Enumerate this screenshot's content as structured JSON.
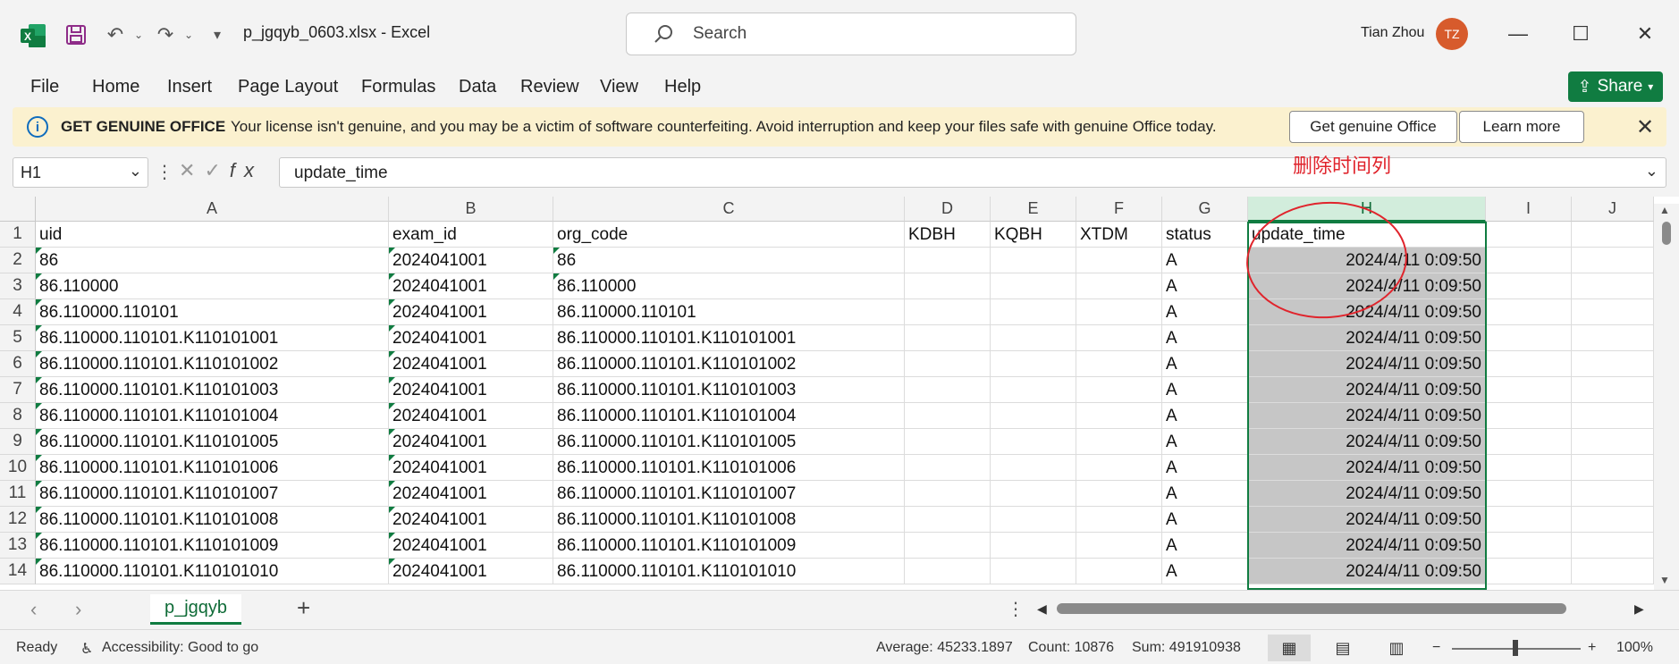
{
  "app": {
    "title": "p_jgqyb_0603.xlsx  -  Excel",
    "search_placeholder": "Search",
    "user_name": "Tian Zhou",
    "user_initials": "TZ"
  },
  "menu": [
    "File",
    "Home",
    "Insert",
    "Page Layout",
    "Formulas",
    "Data",
    "Review",
    "View",
    "Help"
  ],
  "share_label": "Share",
  "banner": {
    "title": "GET GENUINE OFFICE",
    "message": "Your license isn't genuine, and you may be a victim of software counterfeiting. Avoid interruption and keep your files safe with genuine Office today.",
    "primary_button": "Get genuine Office",
    "secondary_button": "Learn more"
  },
  "formula_bar": {
    "name_box": "H1",
    "value": "update_time"
  },
  "annotation": "删除时间列",
  "columns": [
    "A",
    "B",
    "C",
    "D",
    "E",
    "F",
    "G",
    "H",
    "I",
    "J"
  ],
  "selected_column": "H",
  "rows": [
    {
      "n": "1",
      "A": "uid",
      "B": "exam_id",
      "C": "org_code",
      "D": "KDBH",
      "E": "KQBH",
      "F": "XTDM",
      "G": "status",
      "H": "update_time"
    },
    {
      "n": "2",
      "A": "86",
      "B": "2024041001",
      "C": "86",
      "G": "A",
      "H": "2024/4/11 0:09:50"
    },
    {
      "n": "3",
      "A": "86.110000",
      "B": "2024041001",
      "C": "86.110000",
      "G": "A",
      "H": "2024/4/11 0:09:50"
    },
    {
      "n": "4",
      "A": "86.110000.110101",
      "B": "2024041001",
      "C": "86.110000.110101",
      "G": "A",
      "H": "2024/4/11 0:09:50"
    },
    {
      "n": "5",
      "A": "86.110000.110101.K110101001",
      "B": "2024041001",
      "C": "86.110000.110101.K110101001",
      "G": "A",
      "H": "2024/4/11 0:09:50"
    },
    {
      "n": "6",
      "A": "86.110000.110101.K110101002",
      "B": "2024041001",
      "C": "86.110000.110101.K110101002",
      "G": "A",
      "H": "2024/4/11 0:09:50"
    },
    {
      "n": "7",
      "A": "86.110000.110101.K110101003",
      "B": "2024041001",
      "C": "86.110000.110101.K110101003",
      "G": "A",
      "H": "2024/4/11 0:09:50"
    },
    {
      "n": "8",
      "A": "86.110000.110101.K110101004",
      "B": "2024041001",
      "C": "86.110000.110101.K110101004",
      "G": "A",
      "H": "2024/4/11 0:09:50"
    },
    {
      "n": "9",
      "A": "86.110000.110101.K110101005",
      "B": "2024041001",
      "C": "86.110000.110101.K110101005",
      "G": "A",
      "H": "2024/4/11 0:09:50"
    },
    {
      "n": "10",
      "A": "86.110000.110101.K110101006",
      "B": "2024041001",
      "C": "86.110000.110101.K110101006",
      "G": "A",
      "H": "2024/4/11 0:09:50"
    },
    {
      "n": "11",
      "A": "86.110000.110101.K110101007",
      "B": "2024041001",
      "C": "86.110000.110101.K110101007",
      "G": "A",
      "H": "2024/4/11 0:09:50"
    },
    {
      "n": "12",
      "A": "86.110000.110101.K110101008",
      "B": "2024041001",
      "C": "86.110000.110101.K110101008",
      "G": "A",
      "H": "2024/4/11 0:09:50"
    },
    {
      "n": "13",
      "A": "86.110000.110101.K110101009",
      "B": "2024041001",
      "C": "86.110000.110101.K110101009",
      "G": "A",
      "H": "2024/4/11 0:09:50"
    },
    {
      "n": "14",
      "A": "86.110000.110101.K110101010",
      "B": "2024041001",
      "C": "86.110000.110101.K110101010",
      "G": "A",
      "H": "2024/4/11 0:09:50"
    }
  ],
  "sheet_tab": "p_jgqyb",
  "status": {
    "ready": "Ready",
    "accessibility": "Accessibility: Good to go",
    "average": "Average: 45233.1897",
    "count": "Count: 10876",
    "sum": "Sum: 491910938",
    "zoom": "100%"
  },
  "colors": {
    "accent": "#107c41",
    "annotation": "#e0242c",
    "selection_fill": "#c6c6c6"
  }
}
